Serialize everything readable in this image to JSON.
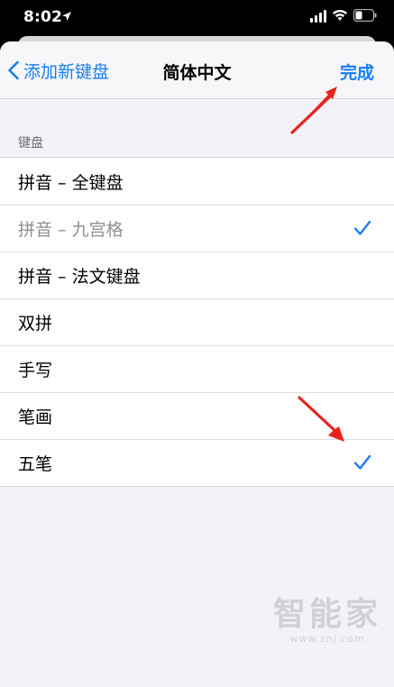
{
  "status_bar": {
    "time": "8:02",
    "icons": [
      "location-icon",
      "signal-icon",
      "wifi-icon",
      "battery-icon"
    ]
  },
  "nav": {
    "back_label": "添加新键盘",
    "title": "简体中文",
    "done_label": "完成"
  },
  "section": {
    "header": "键盘"
  },
  "keyboards": [
    {
      "label": "拼音 – 全键盘",
      "checked": false,
      "dimmed": false
    },
    {
      "label": "拼音 – 九宫格",
      "checked": true,
      "dimmed": true
    },
    {
      "label": "拼音 – 法文键盘",
      "checked": false,
      "dimmed": false
    },
    {
      "label": "双拼",
      "checked": false,
      "dimmed": false
    },
    {
      "label": "手写",
      "checked": false,
      "dimmed": false
    },
    {
      "label": "笔画",
      "checked": false,
      "dimmed": false
    },
    {
      "label": "五笔",
      "checked": true,
      "dimmed": false
    }
  ],
  "watermark": {
    "title": "智能家",
    "url": "www.znj.com"
  },
  "colors": {
    "accent": "#1a7cf5",
    "annotation_arrow": "#e8231b",
    "background": "#f2f2f7"
  }
}
